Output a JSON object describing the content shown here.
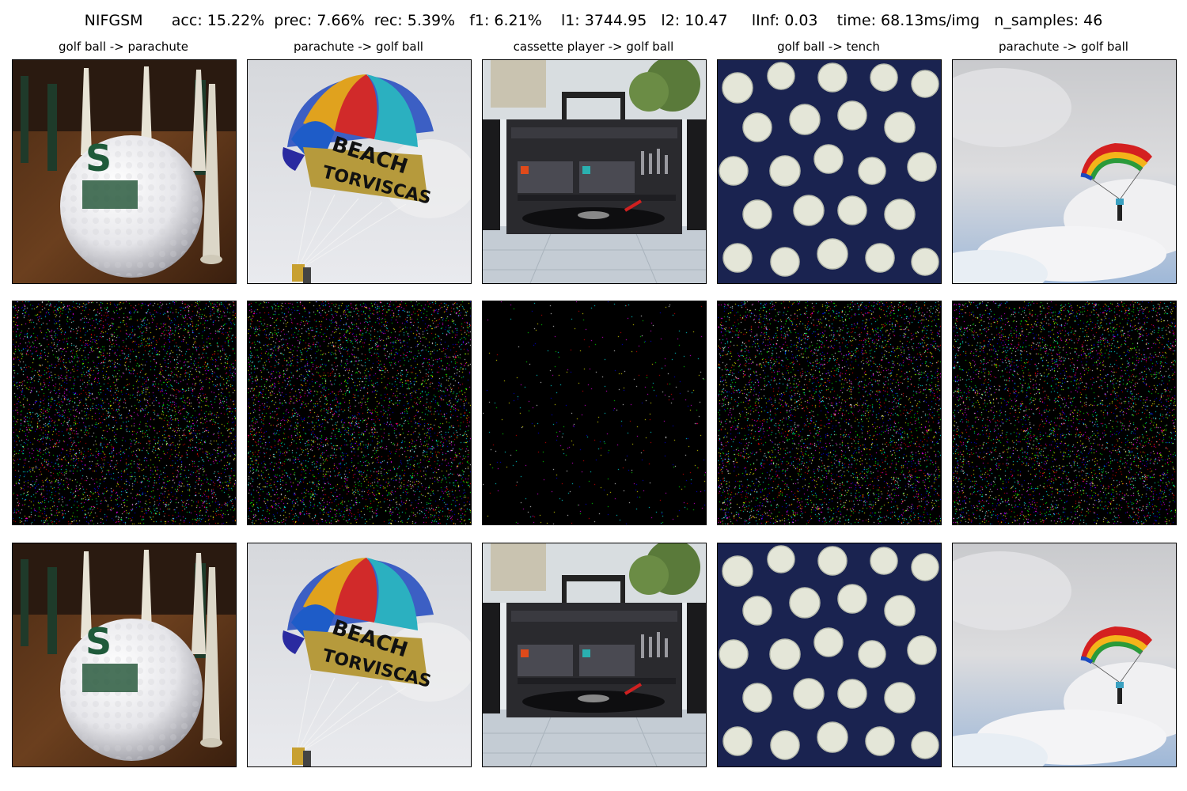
{
  "title": "NIFGSM      acc: 15.22%  prec: 7.66%  rec: 5.39%   f1: 6.21%    l1: 3744.95   l2: 10.47     lInf: 0.03    time: 68.13ms/img   n_samples: 46",
  "columns": [
    {
      "label": "golf ball -> parachute",
      "image": "golf ball with tees"
    },
    {
      "label": "parachute -> golf ball",
      "image": "parachute with BEACH TORVISCAS lettering"
    },
    {
      "label": "cassette player -> golf ball",
      "image": "boombox cassette player with turntable"
    },
    {
      "label": "golf ball -> tench",
      "image": "golf balls on dark blue background"
    },
    {
      "label": "parachute -> golf ball",
      "image": "paraglider in cloudy sky"
    }
  ],
  "rows": [
    "original",
    "perturbation",
    "adversarial"
  ],
  "colors": {
    "noise_background": "#000000",
    "noise_palette": [
      "#ff0000",
      "#00ff00",
      "#0000ff",
      "#ffffff",
      "#ff00ff",
      "#ffff00",
      "#00ffff"
    ]
  }
}
